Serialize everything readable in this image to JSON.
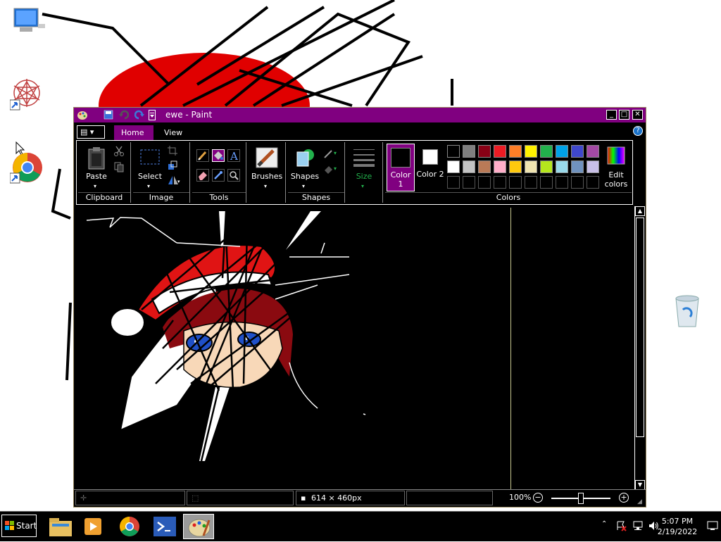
{
  "window": {
    "title": "ewe - Paint",
    "minimize": "_",
    "maximize": "□",
    "close": "✕"
  },
  "tabs": {
    "file": "▤ ▾",
    "home": "Home",
    "view": "View"
  },
  "help": "?",
  "ribbon": {
    "clipboard": {
      "label": "Clipboard",
      "paste": "Paste"
    },
    "image": {
      "label": "Image",
      "select": "Select"
    },
    "tools": {
      "label": "Tools"
    },
    "brushes": {
      "label": "Brushes"
    },
    "shapes": {
      "label": "Shapes",
      "shapes_btn": "Shapes"
    },
    "size": {
      "label": "Size"
    },
    "colors": {
      "label": "Colors",
      "color1": "Color 1",
      "color2": "Color 2",
      "edit": "Edit colors",
      "color1_value": "#000000",
      "color2_value": "#ffffff",
      "palette_row1": [
        "#000000",
        "#7f7f7f",
        "#880015",
        "#ed1c24",
        "#ff7f27",
        "#fff200",
        "#22b14c",
        "#00a2e8",
        "#3f48cc",
        "#a349a4"
      ],
      "palette_row2": [
        "#ffffff",
        "#c3c3c3",
        "#b97a57",
        "#ffaec9",
        "#ffc90e",
        "#efe4b0",
        "#b5e61d",
        "#99d9ea",
        "#7092be",
        "#c8bfe7"
      ]
    }
  },
  "status": {
    "dimensions": "614 × 460px",
    "zoom": "100%"
  },
  "taskbar": {
    "start": "Start",
    "time": "5:07 PM",
    "date": "2/19/2022"
  },
  "colors": {
    "title_bg": "#800080",
    "accent": "#800080"
  }
}
